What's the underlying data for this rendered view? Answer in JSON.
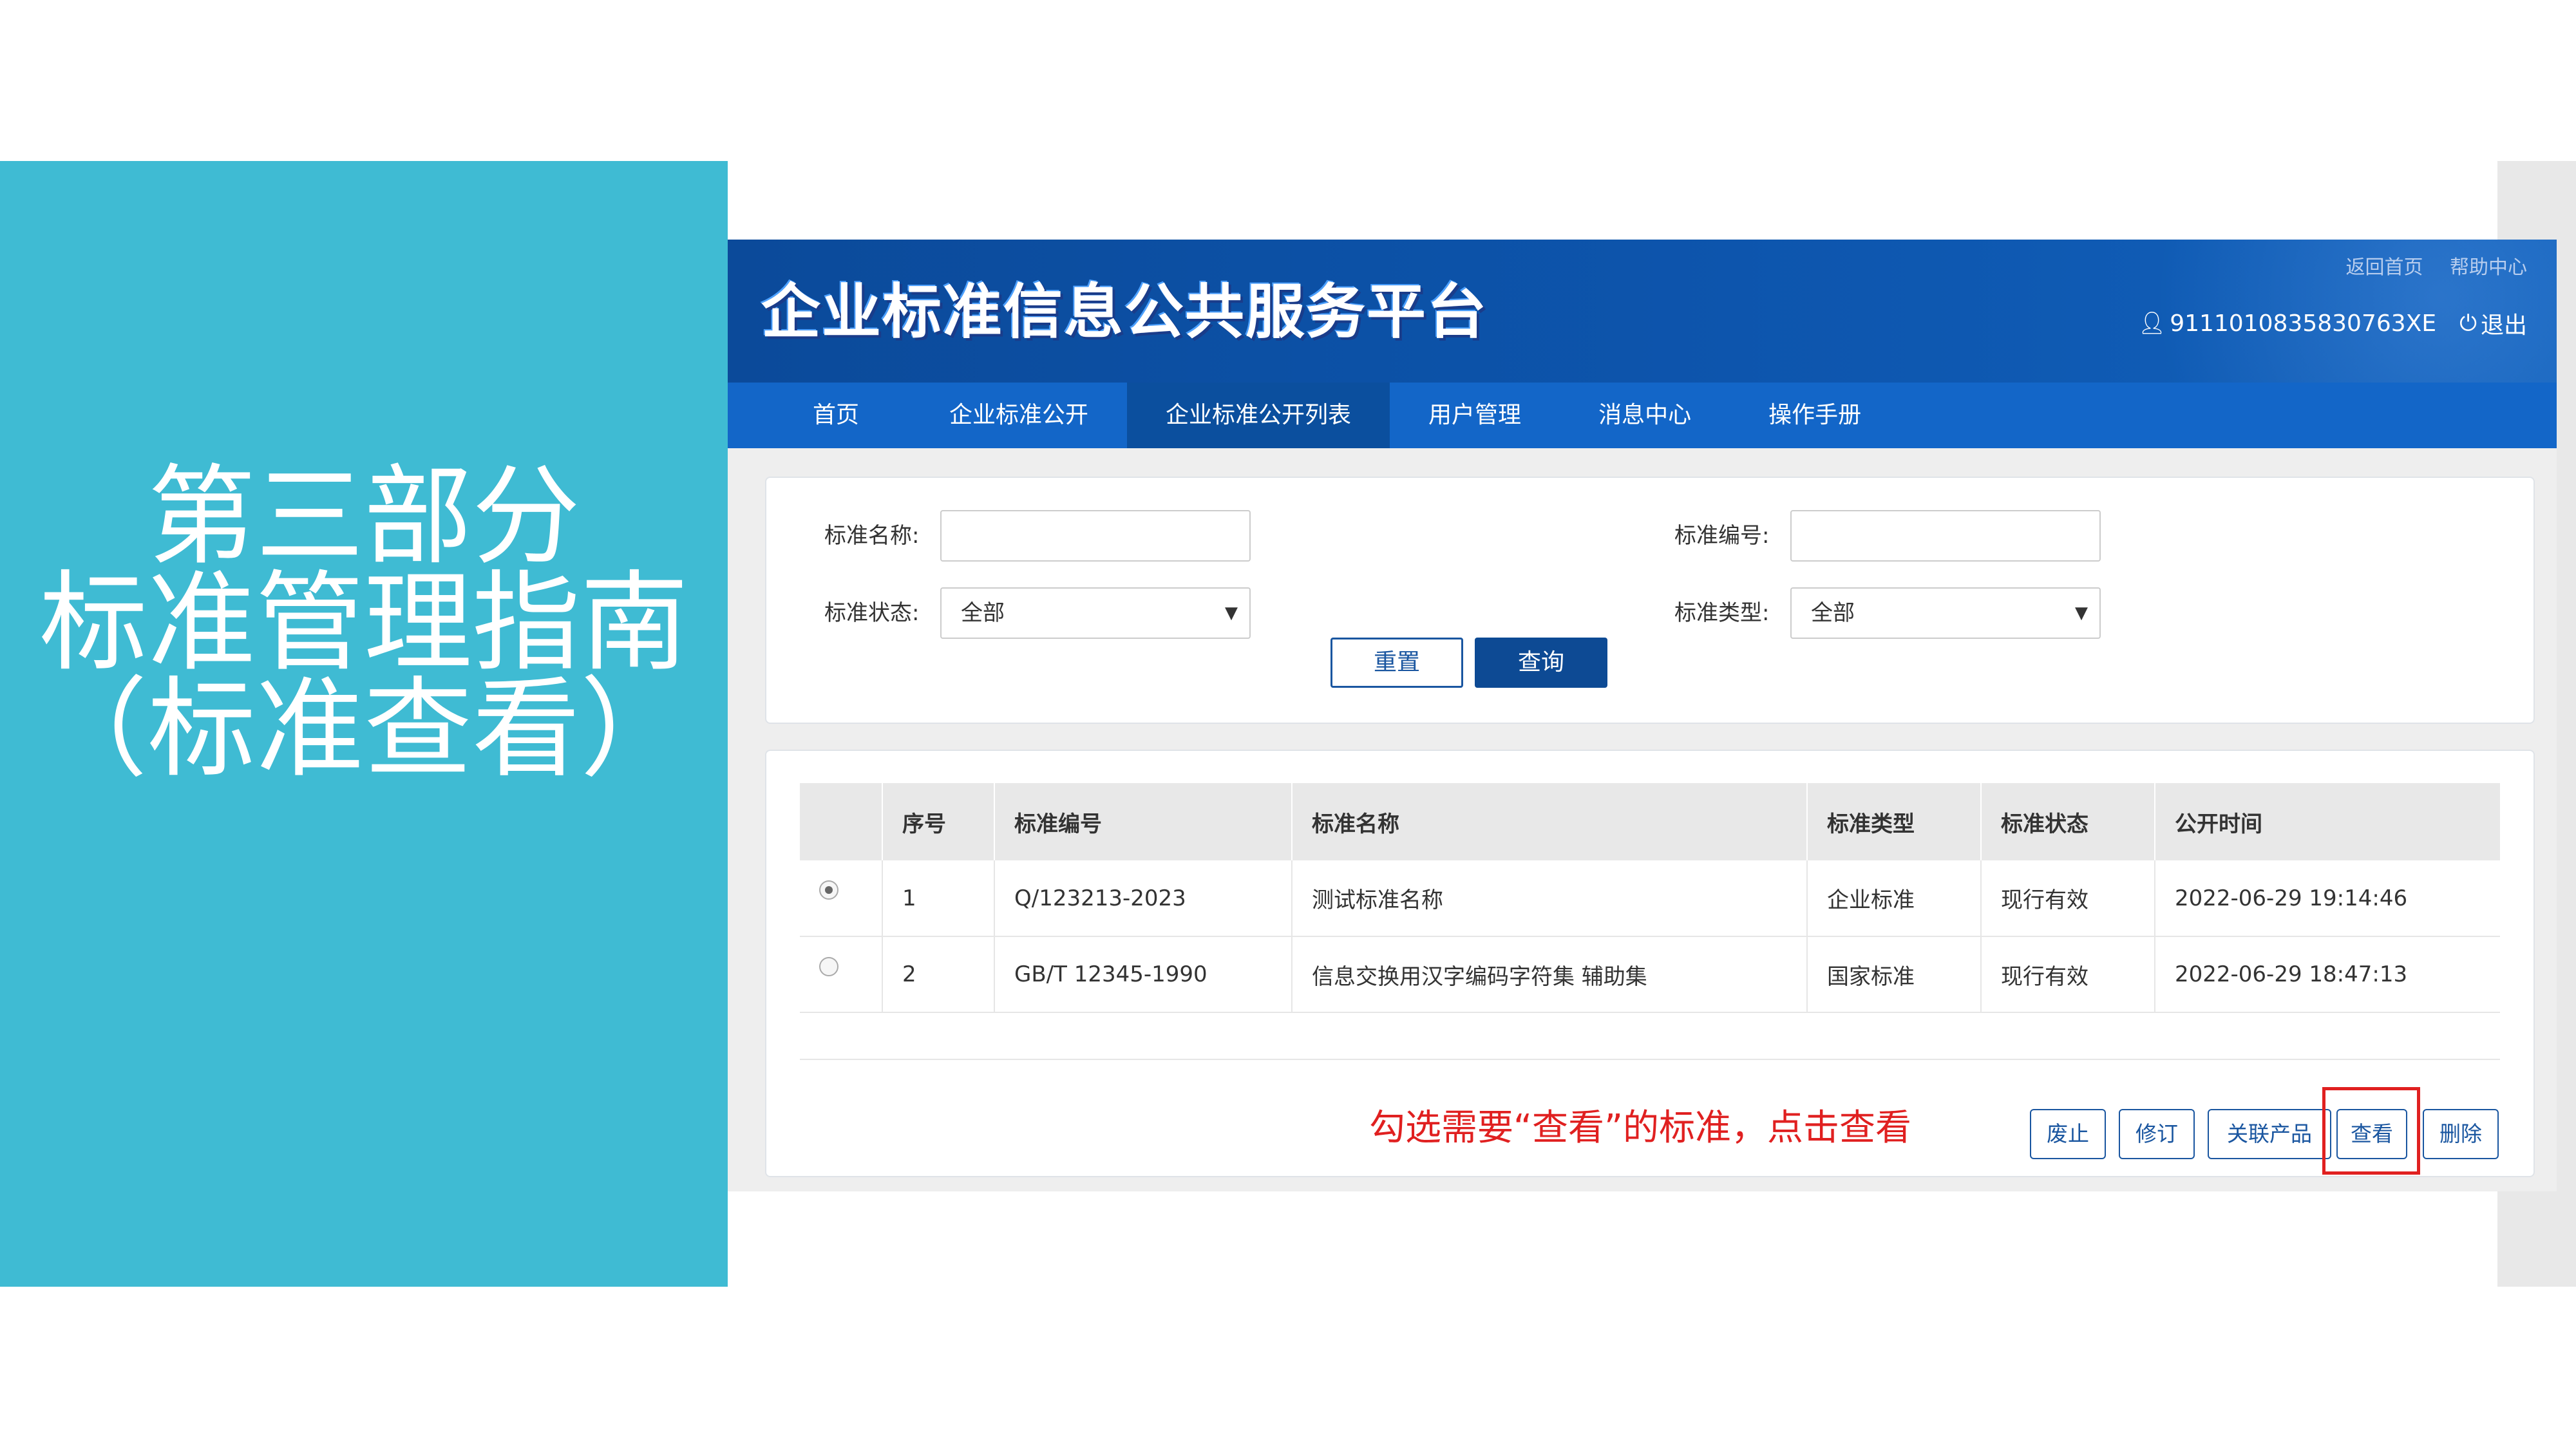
{
  "slide": {
    "title_lines": [
      "第三部分",
      "标准管理指南",
      "（标准查看）"
    ]
  },
  "header": {
    "logo_text": "企业标准信息公共服务平台",
    "links": {
      "home": "返回首页",
      "help": "帮助中心"
    },
    "user_id": "9111010835830763XE",
    "logout": "退出"
  },
  "nav": {
    "items": [
      "首页",
      "企业标准公开",
      "企业标准公开列表",
      "用户管理",
      "消息中心",
      "操作手册"
    ],
    "active_index": 2
  },
  "search": {
    "name_label": "标准名称:",
    "number_label": "标准编号:",
    "status_label": "标准状态:",
    "status_value": "全部",
    "type_label": "标准类型:",
    "type_value": "全部",
    "reset_label": "重置",
    "query_label": "查询"
  },
  "table": {
    "headers": [
      "",
      "序号",
      "标准编号",
      "标准名称",
      "标准类型",
      "标准状态",
      "公开时间"
    ],
    "rows": [
      {
        "selected": true,
        "index": "1",
        "code": "Q/123213-2023",
        "name": "测试标准名称",
        "type": "企业标准",
        "status": "现行有效",
        "time": "2022-06-29 19:14:46"
      },
      {
        "selected": false,
        "index": "2",
        "code": "GB/T 12345-1990",
        "name": "信息交换用汉字编码字符集 辅助集",
        "type": "国家标准",
        "status": "现行有效",
        "time": "2022-06-29 18:47:13"
      }
    ]
  },
  "actions": {
    "instruction": "勾选需要“查看”的标准，点击查看",
    "abolish": "废止",
    "revise": "修订",
    "related": "关联产品",
    "view": "查看",
    "delete": "删除"
  },
  "colors": {
    "slide_panel": "#3fbbd3",
    "header_blue": "#0d55ad",
    "nav_blue": "#1366c8",
    "highlight_red": "#e02020"
  }
}
